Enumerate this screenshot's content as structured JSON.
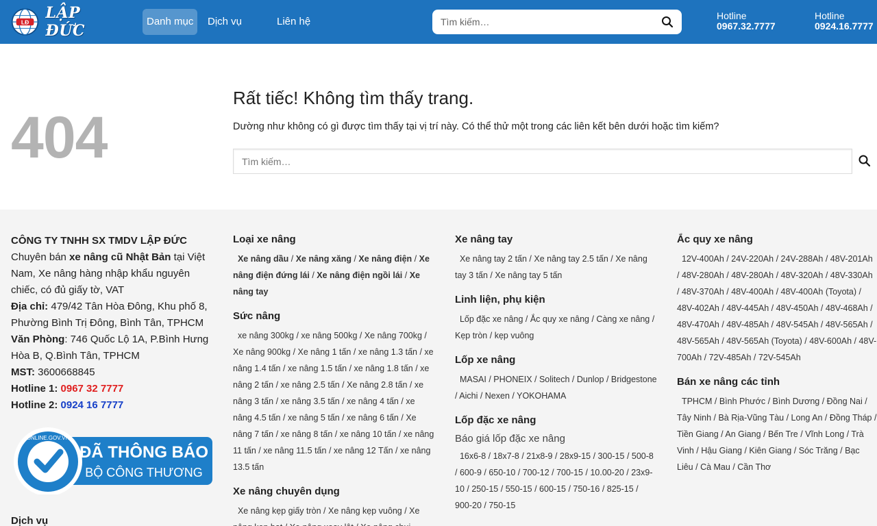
{
  "header": {
    "logo_text": "LẬP ĐỨC",
    "logo_badge": "LĐ",
    "nav": [
      {
        "label": "Danh mục"
      },
      {
        "label": "Dịch vụ"
      },
      {
        "label": "Liên hệ"
      }
    ],
    "search_placeholder": "Tìm kiếm…",
    "hotlines": [
      {
        "label": "Hotline",
        "number": "0967.32.7777"
      },
      {
        "label": "Hotline",
        "number": "0924.16.7777"
      }
    ]
  },
  "error": {
    "code": "404",
    "title": "Rất tiếc! Không tìm thấy trang.",
    "description": "Dường như không có gì được tìm thấy tại vị trí này. Có thể thử một trong các liên kết bên dưới hoặc tìm kiếm?",
    "search_placeholder": "Tìm kiếm…"
  },
  "company": {
    "name": "CÔNG TY TNHH SX TMDV LẬP ĐỨC",
    "intro_prefix": "Chuyên bán ",
    "intro_bold": "xe nâng cũ Nhật Bản",
    "intro_suffix": " tại Việt Nam, Xe nâng hàng nhập khẩu nguyên chiếc, có đủ giấy tờ, VAT",
    "address_label": "Địa chỉ:",
    "address": " 479/42 Tân Hòa Đông, Khu phố 8, Phường Bình Trị Đông, Bình Tân, TPHCM",
    "office_label": "Văn Phòng",
    "office": ": 746 Quốc Lộ 1A, P.Bình Hưng Hòa B, Q.Bình Tân, TPHCM",
    "mst_label": "MST:",
    "mst": " 3600668845",
    "hotline1_label": "Hotline 1: ",
    "hotline1": "0967 32 7777",
    "hotline2_label": "Hotline 2: ",
    "hotline2": "0924 16 7777",
    "badge_line1": "ĐÃ THÔNG BÁO",
    "badge_line2": "BỘ CÔNG THƯƠNG",
    "badge_ring": "ONLINE.GOV.VN",
    "bottom_title": "Dịch vụ"
  },
  "col2": {
    "sections": [
      {
        "title": "Loại xe nâng",
        "bold": true,
        "links": [
          "Xe nâng dầu",
          "Xe nâng xăng",
          "Xe nâng điện",
          "Xe nâng điện đứng lái",
          "Xe nâng điện ngồi lái",
          "Xe nâng tay"
        ]
      },
      {
        "title": "Sức nâng",
        "bold": false,
        "links": [
          "xe nâng 300kg",
          "xe nâng 500kg",
          "Xe nâng 700kg",
          "Xe nâng 900kg",
          "Xe nâng 1 tấn",
          "xe nâng 1.3 tấn",
          "xe nâng 1.4 tấn",
          "xe nâng 1.5 tấn",
          "xe nâng 1.8 tấn",
          "xe nâng 2 tấn",
          "xe nâng 2.5 tấn",
          "Xe nâng 2.8 tấn",
          "xe nâng 3 tấn",
          "xe nâng 3.5 tấn",
          "xe nâng 4 tấn",
          "xe nâng 4.5 tấn",
          "xe nâng 5 tấn",
          "xe nâng 6 tấn",
          "Xe nâng 7 tấn",
          "xe nâng 8 tấn",
          "xe nâng 10 tấn",
          "xe nâng 11 tấn",
          "xe nâng 11.5 tấn",
          "xe nâng 12 Tấn",
          "xe nâng 13.5 tấn"
        ]
      },
      {
        "title": "Xe nâng chuyên dụng",
        "bold": false,
        "links": [
          "Xe nâng kẹp giấy tròn",
          "Xe nâng kẹp vuông",
          "Xe nâng kẹp bạt",
          "Xe nâng xoay lật",
          "Xe nâng chui"
        ]
      }
    ]
  },
  "col3": {
    "sections": [
      {
        "title": "Xe nâng tay",
        "sub": "",
        "links": [
          "Xe nâng tay 2 tấn",
          "Xe nâng tay 2.5 tấn",
          "Xe nâng tay 3 tấn",
          "Xe nâng tay 5 tấn"
        ]
      },
      {
        "title": "Linh liện, phụ kiện",
        "sub": "",
        "links": [
          "Lốp đặc xe nâng",
          "Ắc quy xe nâng",
          "Càng xe nâng",
          "Kẹp tròn",
          "kẹp vuông"
        ]
      },
      {
        "title": "Lốp xe nâng",
        "sub": "",
        "links": [
          "MASAI",
          "PHONEIX",
          "Solitech",
          "Dunlop",
          "Bridgestone",
          "Aichi",
          "Nexen",
          "YOKOHAMA"
        ]
      },
      {
        "title": "Lốp đặc xe nâng",
        "sub": "Báo giá lốp đặc xe nâng",
        "links": [
          "16x6-8",
          "18x7-8",
          "21x8-9",
          "28x9-15",
          "300-15",
          "500-8",
          "600-9",
          "650-10",
          "700-12",
          "700-15",
          "10.00-20",
          "23x9-10",
          "250-15",
          "550-15",
          "600-15",
          "750-16",
          "825-15",
          "900-20",
          "750-15"
        ]
      }
    ]
  },
  "col4": {
    "sections": [
      {
        "title": "Ắc quy xe nâng",
        "links": [
          "12V-400Ah",
          "24V-220Ah",
          "24V-288Ah",
          "48V-201Ah",
          "48V-280Ah",
          "48V-280Ah",
          "48V-320Ah",
          "48V-330Ah",
          "48V-370Ah",
          "48V-400Ah",
          "48V-400Ah (Toyota)",
          "48V-402Ah",
          "48V-445Ah",
          "48V-450Ah",
          "48V-468Ah",
          "48V-470Ah",
          "48V-485Ah",
          "48V-545Ah",
          "48V-565Ah",
          "48V-565Ah",
          "48V-565Ah (Toyota)",
          "48V-600Ah",
          "48V-700Ah",
          "72V-485Ah",
          "72V-545Ah"
        ]
      },
      {
        "title": "Bán xe nâng các tỉnh",
        "links": [
          "TPHCM",
          "Bình Phước",
          "Bình Dương",
          "Đồng Nai",
          "Tây Ninh",
          "Bà Rịa-Vũng Tàu",
          "Long An",
          "Đồng Tháp",
          "Tiền Giang",
          "An Giang",
          "Bến Tre",
          "Vĩnh Long",
          "Trà Vinh",
          "Hậu Giang",
          "Kiên Giang",
          "Sóc Trăng",
          "Bạc Liêu",
          "Cà Mau",
          "Cần Thơ"
        ]
      }
    ]
  },
  "colors": {
    "header_bg": "#1e73be",
    "hotline1": "#e01f1f",
    "hotline2": "#1740c8",
    "error_code": "#b3b3b3",
    "footer_bg": "#f4f4f4",
    "badge_blue": "#1e7fc9"
  }
}
